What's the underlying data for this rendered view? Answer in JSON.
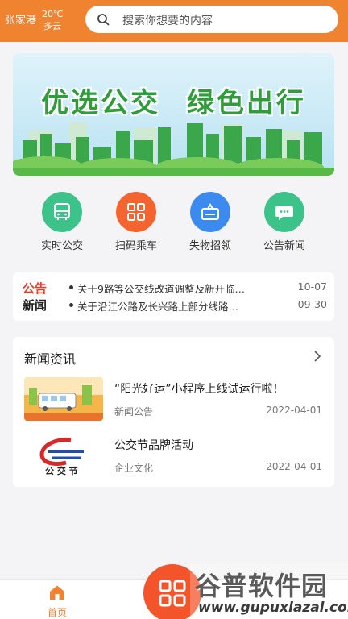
{
  "header": {
    "location": "张家港",
    "temperature": "20℃",
    "weather": "多云",
    "search_placeholder": "搜索你想要的内容",
    "color": "#f08330"
  },
  "banner": {
    "slogan": "优选公交 绿色出行"
  },
  "quick_menu": [
    {
      "label": "实时公交",
      "icon": "bus-icon",
      "color": "#3cc38a"
    },
    {
      "label": "扫码乘车",
      "icon": "qr-scan-icon",
      "color": "#f4642e"
    },
    {
      "label": "失物招领",
      "icon": "lost-found-icon",
      "color": "#3b8af0"
    },
    {
      "label": "公告新闻",
      "icon": "chat-bubble-icon",
      "color": "#3cc38a"
    }
  ],
  "notice": {
    "logo_line1": "公告",
    "logo_line2": "新闻",
    "items": [
      {
        "title": "关于9路等公交线改道调整及新开临…",
        "date": "10-07"
      },
      {
        "title": "关于沿江公路及长兴路上部分线路…",
        "date": "09-30"
      }
    ]
  },
  "news": {
    "heading": "新闻资讯",
    "items": [
      {
        "title": "“阳光好运”小程序上线试运行啦！",
        "category": "新闻公告",
        "date": "2022-04-01"
      },
      {
        "title": "公交节品牌活动",
        "category": "企业文化",
        "date": "2022-04-01"
      }
    ]
  },
  "tabbar": {
    "home_label": "首页",
    "accent": "#f08330"
  },
  "watermark": {
    "title": "谷普软件园",
    "url": "www.gupuxlazal.com"
  }
}
